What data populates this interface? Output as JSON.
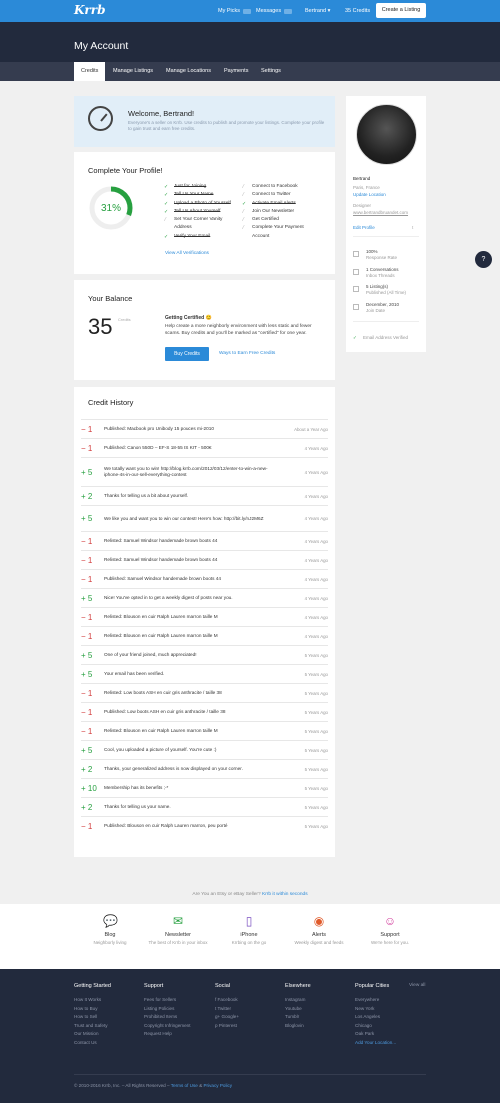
{
  "nav": {
    "logo": "Krrb",
    "my_picks": "My Picks",
    "messages": "Messages",
    "user": "Bertrand ▾",
    "credits": "35 Credits",
    "create": "Create a Listing"
  },
  "page_title": "My Account",
  "tabs": [
    "Credits",
    "Manage Listings",
    "Manage Locations",
    "Payments",
    "Settings"
  ],
  "welcome": {
    "title": "Welcome, Bertrand!",
    "text": "Everyone's a seller on Krrb. Use credits to publish and promote your listings. Complete your profile to gain trust and earn free credits."
  },
  "profile": {
    "title": "Complete Your Profile!",
    "percent": "31%",
    "percent_value": 31,
    "left": [
      {
        "t": "Just for Joining",
        "s": "done"
      },
      {
        "t": "Tell Us Your Name",
        "s": "done"
      },
      {
        "t": "Upload a Photo of Yourself",
        "s": "done"
      },
      {
        "t": "Tell Us About Yourself",
        "s": "done"
      },
      {
        "t": "Set Your Corner Vanity",
        "s": "no"
      },
      {
        "t": "Address",
        "s": "cont"
      },
      {
        "t": "Verify Your Email",
        "s": "done"
      }
    ],
    "right": [
      {
        "t": "Connect to Facebook",
        "s": "no"
      },
      {
        "t": "Connect to Twitter",
        "s": "no"
      },
      {
        "t": "Activate Email Alerts",
        "s": "done"
      },
      {
        "t": "Join Our Newsletter",
        "s": "no"
      },
      {
        "t": "Get Certified",
        "s": "no"
      },
      {
        "t": "Complete Your Payment",
        "s": "no"
      },
      {
        "t": "Account",
        "s": "cont"
      }
    ],
    "view_all": "View All Verifications"
  },
  "balance": {
    "title": "Your Balance",
    "amount": "35",
    "unit": "Credits",
    "gc_title": "Getting Certified 😊",
    "gc_text": "Help create a more neighborly environment with less static and fewer scams. Buy credits and you'll be marked as \"certified\" for one year.",
    "buy": "Buy Credits",
    "ways": "Ways to Earn Free Credits"
  },
  "history": {
    "title": "Credit History",
    "rows": [
      {
        "a": "− 1",
        "n": true,
        "t": "Published: Macbook pro Unibody 15 pouces mi-2010",
        "d": "About a Year Ago"
      },
      {
        "a": "− 1",
        "n": true,
        "t": "Published: Canon 550D – EF-S 18-55 IS KIT - 500€",
        "d": "4 Years Ago"
      },
      {
        "a": "+ 5",
        "n": false,
        "t": "We totally want you to win! http://blog.krrb.com/2012/03/12/enter-to-win-a-new-iphone-4s-in-our-sell-everything-contest",
        "d": "4 Years Ago"
      },
      {
        "a": "+ 2",
        "n": false,
        "t": "Thanks for telling us a bit about yourself.",
        "d": "4 Years Ago"
      },
      {
        "a": "+ 5",
        "n": false,
        "t": "We like you and want you to win our contest! Here's how: http://bit.ly/nJ2M6Z",
        "d": "4 Years Ago"
      },
      {
        "a": "− 1",
        "n": true,
        "t": "Relisted: Samuel Windsor handemade brown boots 44",
        "d": "4 Years Ago"
      },
      {
        "a": "− 1",
        "n": true,
        "t": "Relisted: Samuel Windsor handemade brown boots 44",
        "d": "4 Years Ago"
      },
      {
        "a": "− 1",
        "n": true,
        "t": "Published: Samuel Windsor handemade brown boots 44",
        "d": "4 Years Ago"
      },
      {
        "a": "+ 5",
        "n": false,
        "t": "Nice! You've opted in to get a weekly digest of posts near you.",
        "d": "4 Years Ago"
      },
      {
        "a": "− 1",
        "n": true,
        "t": "Relisted: Blouson en cuir Ralph Lauren marron taille M",
        "d": "4 Years Ago"
      },
      {
        "a": "− 1",
        "n": true,
        "t": "Relisted: Blouson en cuir Ralph Lauren marron taille M",
        "d": "4 Years Ago"
      },
      {
        "a": "+ 5",
        "n": false,
        "t": "One of your friend joined, much appreciated!",
        "d": "5 Years Ago"
      },
      {
        "a": "+ 5",
        "n": false,
        "t": "Your email has been verified.",
        "d": "5 Years Ago"
      },
      {
        "a": "− 1",
        "n": true,
        "t": "Relisted: Low boots ASH en cuir gris anthracite / taille 38",
        "d": "5 Years Ago"
      },
      {
        "a": "− 1",
        "n": true,
        "t": "Published: Low boots ASH en cuir gris anthracite / taille 38",
        "d": "5 Years Ago"
      },
      {
        "a": "− 1",
        "n": true,
        "t": "Relisted: Blouson en cuir Ralph Lauren marron taille M",
        "d": "5 Years Ago"
      },
      {
        "a": "+ 5",
        "n": false,
        "t": "Cool, you uploaded a picture of yourself. You're cute :)",
        "d": "5 Years Ago"
      },
      {
        "a": "+ 2",
        "n": false,
        "t": "Thanks, your generalized address is now displayed on your corner.",
        "d": "5 Years Ago"
      },
      {
        "a": "+ 10",
        "n": false,
        "t": "Membership has its benefits ;-*",
        "d": "5 Years Ago"
      },
      {
        "a": "+ 2",
        "n": false,
        "t": "Thanks for telling us your name.",
        "d": "5 Years Ago"
      },
      {
        "a": "− 1",
        "n": true,
        "t": "Published: Blouson en cuir Ralph Lauren marron, peu porté",
        "d": "5 Years Ago"
      }
    ]
  },
  "sidebar": {
    "name": "Bertrand",
    "location": "Paris, France",
    "update_location": "Update Location",
    "role": "Designer",
    "website": "www.bertrandbruandet.com",
    "edit": "Edit Profile",
    "response_rate": "100%",
    "response_label": "Response Rate",
    "conversations": "1 Conversations",
    "conversations_label": "Inbox Threads",
    "listings": "5 Listing(s)",
    "listings_label": "Published (All Time)",
    "join": "December, 2010",
    "join_label": "Join Date",
    "verified": "Email Address Verified"
  },
  "etsy": {
    "q": "Are You an Etsy or eBay Seller?",
    "link": "Krrb it within seconds"
  },
  "tiles": [
    {
      "name": "Blog",
      "sub": "Neighborly living",
      "icon": "💬",
      "color": "#2b8ad8"
    },
    {
      "name": "Newsletter",
      "sub": "The best of Krrb in your inbox",
      "icon": "✉",
      "color": "#27a040"
    },
    {
      "name": "iPhone",
      "sub": "Krrbing on the go",
      "icon": "▯",
      "color": "#7a4fc0"
    },
    {
      "name": "Alerts",
      "sub": "Weekly digest and feeds",
      "icon": "◉",
      "color": "#e05a2a"
    },
    {
      "name": "Support",
      "sub": "We're here for you.",
      "icon": "☺",
      "color": "#d23c9c"
    }
  ],
  "footer": {
    "cols": [
      {
        "title": "Getting Started",
        "items": [
          "How It Works",
          "How to Buy",
          "How to Sell",
          "Trust and Safety",
          "Our Mission",
          "Contact Us"
        ]
      },
      {
        "title": "Support",
        "items": [
          "Fees for Sellers",
          "Listing Policies",
          "Prohibited Items",
          "Copyright Infringement",
          "Request Help"
        ]
      },
      {
        "title": "Social",
        "items": [
          "f  Facebook",
          "t  Twitter",
          "g+ Google+",
          "p  Pinterest"
        ]
      },
      {
        "title": "Elsewhere",
        "items": [
          "Instagram",
          "Youtube",
          "Tumblr",
          "Bloglovin"
        ]
      },
      {
        "title": "Popular Cities",
        "items": [
          "Everywhere",
          "New York",
          "Los Angeles",
          "Chicago",
          "Oak Park",
          "Add Your Location..."
        ]
      }
    ],
    "view_all": "View all",
    "copy": "© 2010-2016 Krrb, Inc. – All Rights Reserved –",
    "terms": "Terms of Use",
    "and": "&",
    "privacy": "Privacy Policy"
  }
}
